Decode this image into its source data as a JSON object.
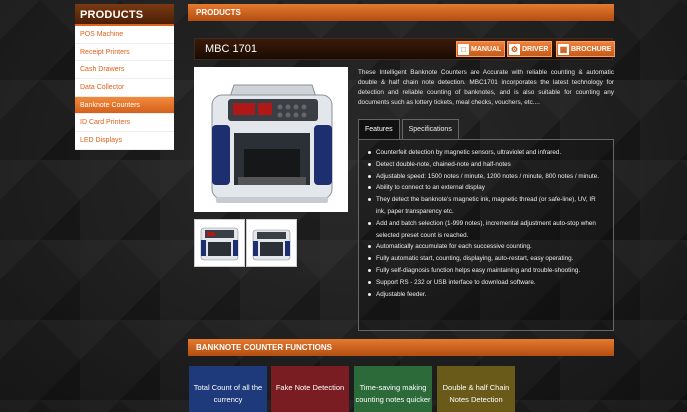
{
  "sidebar": {
    "title": "PRODUCTS",
    "items": [
      {
        "label": "POS Machine"
      },
      {
        "label": "Receipt Printers"
      },
      {
        "label": "Cash Drawers"
      },
      {
        "label": "Data Collector"
      },
      {
        "label": "Banknote Counters"
      },
      {
        "label": "ID Card Printers"
      },
      {
        "label": "LED Displays"
      }
    ],
    "active_index": 4
  },
  "products_bar": {
    "title": "PRODUCTS"
  },
  "product": {
    "name": "MBC 1701",
    "buttons": [
      {
        "label": "MANUAL",
        "icon": "manual-icon"
      },
      {
        "label": "DRIVER",
        "icon": "gear-icon"
      },
      {
        "label": "BROCHURE",
        "icon": "brochure-icon"
      }
    ],
    "description": "These Intelligent Banknote Counters are Accurate with reliable counting & automatic double & half chain note detection. MBC1701 incorporates the latest technology for detection and reliable counting of banknotes, and is also suitable for counting any documents such as lottery tickets, meal checks, vouchers, etc....",
    "tabs": [
      {
        "label": "Features"
      },
      {
        "label": "Specifications"
      }
    ],
    "features": [
      "Counterfeit detection by magnetic sensors, ultraviolet and infrared.",
      "Detect double-note, chained-note and half-notes",
      "Adjustable speed: 1500 notes / minute, 1200 notes / minute, 800 notes / minute.",
      "Ability to connect to an external display",
      "They detect the banknote's magnetic ink, magnetic thread (or safe-line), UV, IR ink, paper transparency etc.",
      "Add and batch selection (1-999 notes), incremental adjustment auto-stop when selected preset count is reached.",
      "Automatically accumulate for each successive counting.",
      "Fully automatic start, counting, displaying, auto-restart, easy operating.",
      "Fully self-diagnosis function helps easy maintaining and trouble-shooting.",
      "Support RS - 232 or USB interface to download software.",
      "Adjustable feeder."
    ]
  },
  "functions_bar": {
    "title": "BANKNOTE COUNTER FUNCTIONS"
  },
  "functions": [
    {
      "label": "Total Count of all the currency",
      "color": "#1f3a7a"
    },
    {
      "label": "Fake Note Detection",
      "color": "#7a1d22"
    },
    {
      "label": "Time-saving making counting notes quicker",
      "color": "#2d6a3a"
    },
    {
      "label": "Double & half Chain Notes Detection",
      "color": "#6a5a1a"
    }
  ],
  "colors": {
    "accent": "#e0601b"
  }
}
